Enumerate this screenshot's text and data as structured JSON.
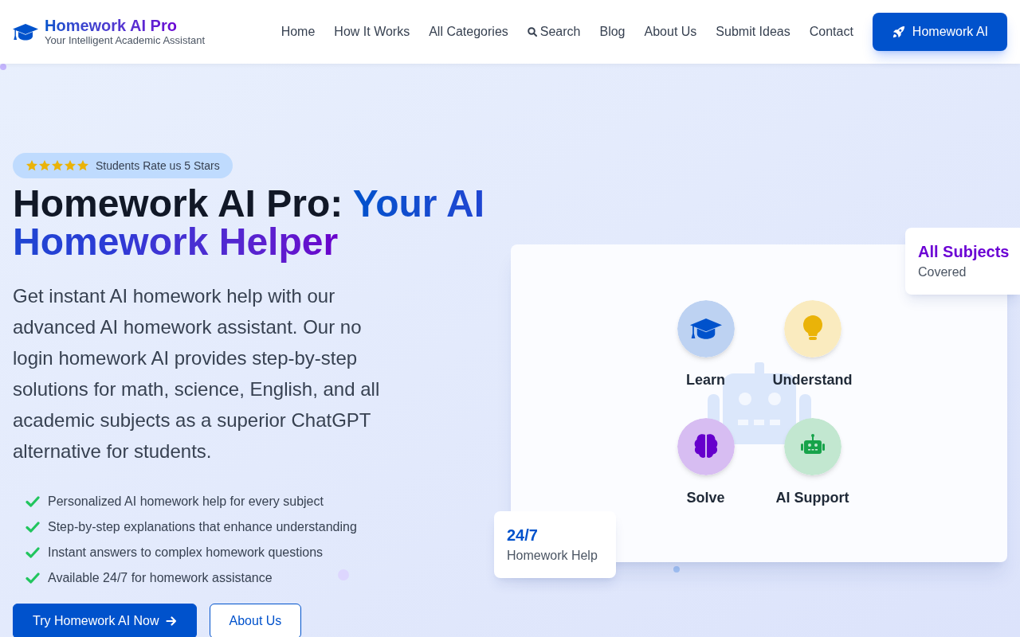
{
  "header": {
    "logo": {
      "title": "Homework AI Pro",
      "tagline": "Your Intelligent Academic Assistant"
    },
    "nav": [
      {
        "label": "Home",
        "kind": "link"
      },
      {
        "label": "How It Works",
        "kind": "link"
      },
      {
        "label": "All Categories",
        "kind": "link"
      },
      {
        "label": "Search",
        "kind": "search"
      },
      {
        "label": "Blog",
        "kind": "link"
      },
      {
        "label": "About Us",
        "kind": "link"
      },
      {
        "label": "Submit Ideas",
        "kind": "link"
      },
      {
        "label": "Contact",
        "kind": "link"
      }
    ],
    "cta_button": {
      "label": "Homework AI"
    }
  },
  "hero": {
    "rating_badge": {
      "stars": 5,
      "text": "Students Rate us 5 Stars"
    },
    "title": {
      "lead": "Homework AI Pro:",
      "highlight": "Your AI Homework Helper"
    },
    "description": "Get instant AI homework help with our advanced AI homework assistant. Our no login homework AI provides step-by-step solutions for math, science, English, and all academic subjects as a superior ChatGPT alternative for students.",
    "features": [
      "Personalized AI homework help for every subject",
      "Step-by-step explanations that enhance understanding",
      "Instant answers to complex homework questions",
      "Available 24/7 for homework assistance"
    ],
    "buttons": [
      {
        "label": "Try Homework AI Now",
        "kind": "primary"
      },
      {
        "label": "About Us",
        "kind": "secondary"
      }
    ]
  },
  "showcase": {
    "items": [
      {
        "label": "Learn",
        "color": "#0052cc"
      },
      {
        "label": "Understand",
        "color": "#eab308"
      },
      {
        "label": "Solve",
        "color": "#6600cc"
      },
      {
        "label": "AI Support",
        "color": "#16a34a"
      }
    ],
    "stats": [
      {
        "value": "All Subjects",
        "label": "Covered",
        "color": "#6b00d4"
      },
      {
        "value": "24/7",
        "label": "Homework Help",
        "color": "#0052cc"
      }
    ]
  }
}
